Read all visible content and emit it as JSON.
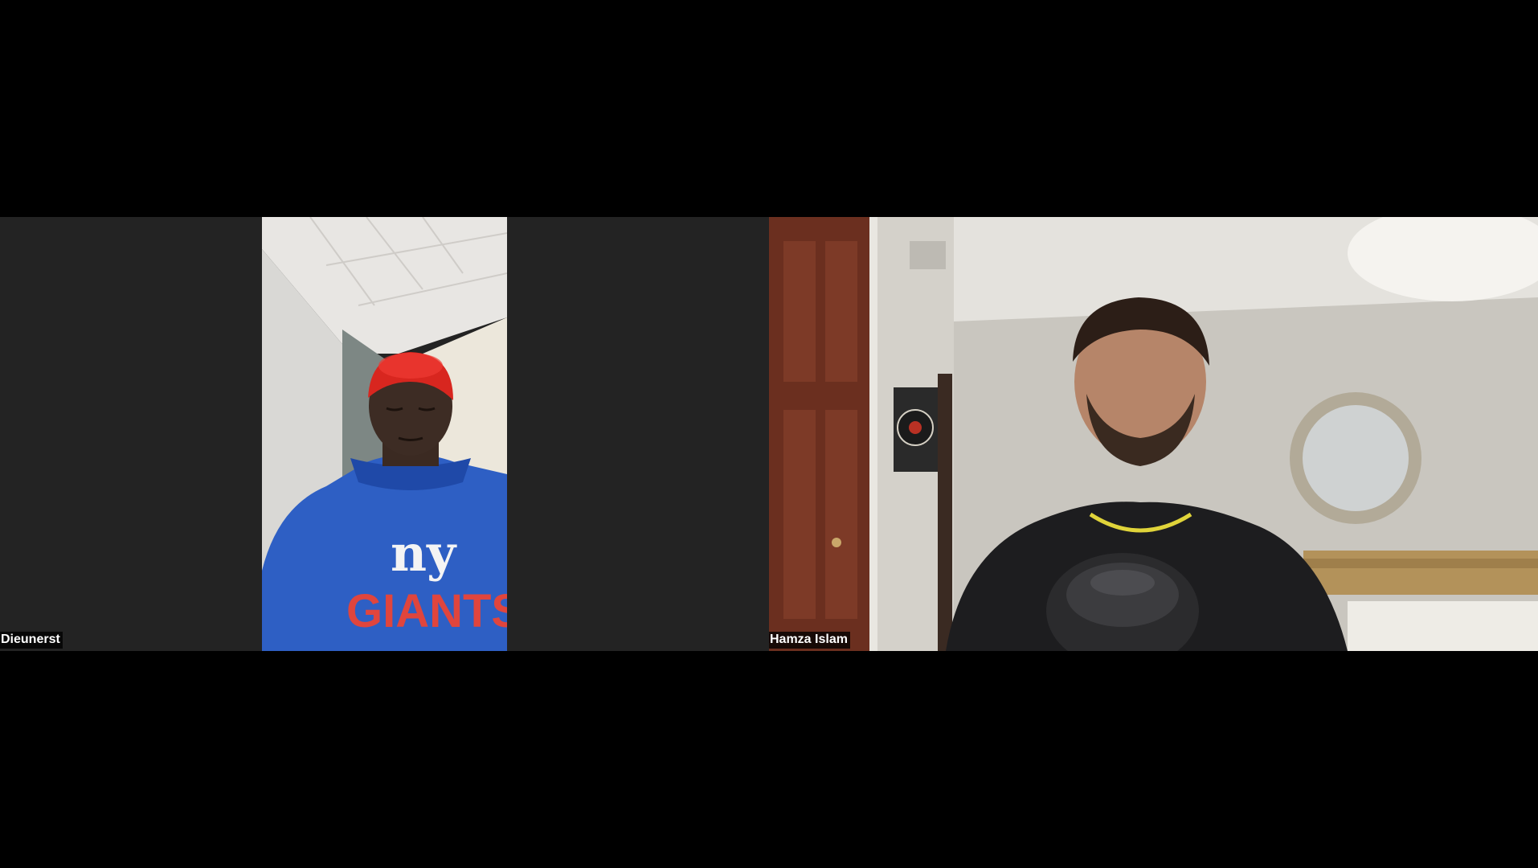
{
  "participants": [
    {
      "name": "Dieunerst",
      "shirt_text_top": "ny",
      "shirt_text_bottom": "GIANTS"
    },
    {
      "name": "Hamza Islam"
    }
  ],
  "colors": {
    "background": "#000000",
    "tile_background": "#232323",
    "label_background": "#000000",
    "label_text": "#ffffff"
  }
}
